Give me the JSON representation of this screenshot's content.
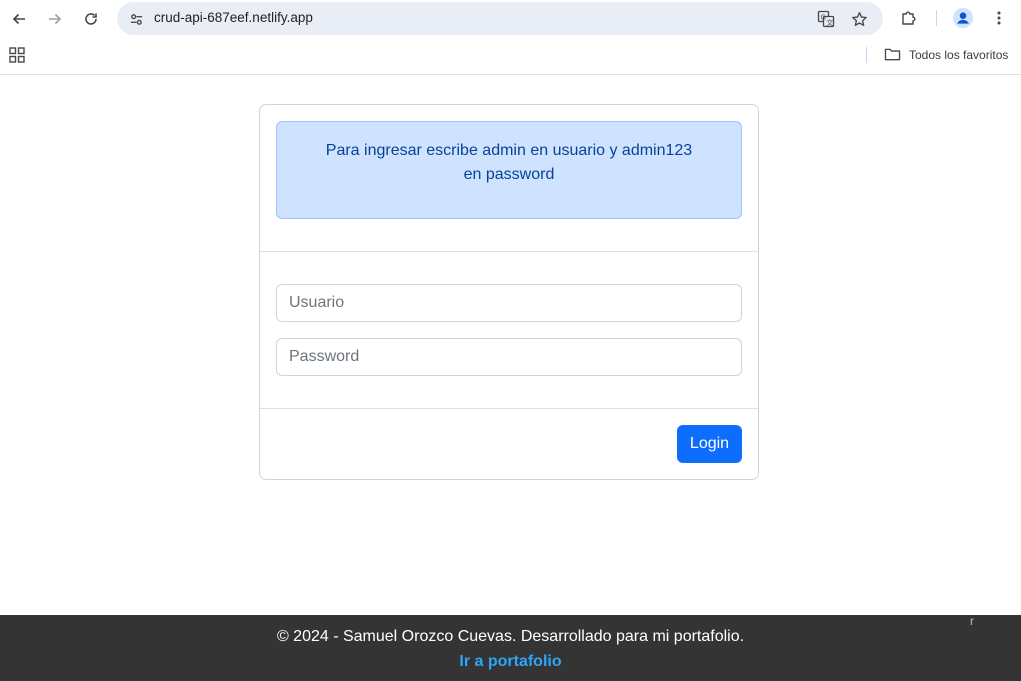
{
  "browser": {
    "url": "crud-api-687eef.netlify.app",
    "bookmarks_folder": "Todos los favoritos"
  },
  "alert": {
    "message": "Para ingresar escribe admin en usuario y admin123 en password"
  },
  "form": {
    "username_placeholder": "Usuario",
    "password_placeholder": "Password",
    "login_label": "Login"
  },
  "footer": {
    "copyright": "© 2024 - Samuel Orozco Cuevas. Desarrollado para mi portafolio.",
    "portfolio_link": "Ir a portafolio",
    "stray_char": "r"
  },
  "colors": {
    "primary": "#0d6efd",
    "alert_bg": "#cfe2ff",
    "alert_text": "#084298",
    "footer_bg": "#343434",
    "footer_link": "#2ea6f7"
  }
}
